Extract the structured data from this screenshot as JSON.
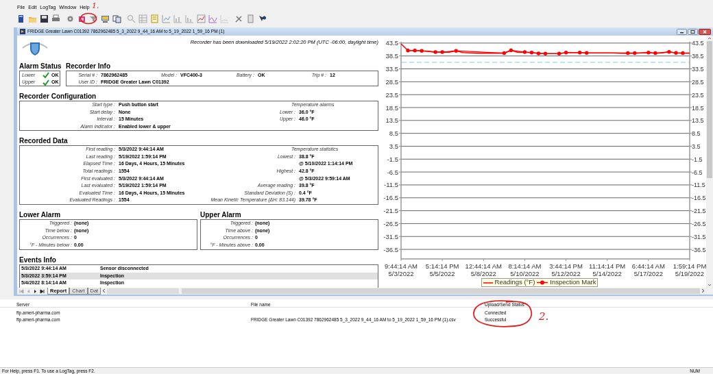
{
  "menu": [
    "File",
    "Edit",
    "LogTag",
    "Window",
    "Help"
  ],
  "markup": [
    {
      "text": "1."
    },
    {
      "text": "2."
    }
  ],
  "document": {
    "title": "FRIDGE Greater Lawn C01392 7862962485 5_3_2022 9_44_16 AM to 5_19_2022 1_59_16 PM (1)",
    "downloaded": "Recorder has been downloaded 5/19/2022 2:02:20 PM (UTC -06:00, daylight time)",
    "alarm_status": {
      "title": "Alarm Status",
      "rows": [
        {
          "label": "Lower",
          "value": "OK",
          "ok": true
        },
        {
          "label": "Upper",
          "value": "OK",
          "ok": true
        }
      ]
    },
    "recorder_info": {
      "title": "Recorder Info",
      "fields": [
        {
          "label": "Serial # :",
          "value": "7862962485"
        },
        {
          "label": "Model :",
          "value": "VFC400-3"
        },
        {
          "label": "Battery :",
          "value": "OK"
        },
        {
          "label": "Trip # :",
          "value": "12"
        },
        {
          "label": "User ID :",
          "value": "FRIDGE Greater Lawn C01392"
        }
      ]
    },
    "recorder_configuration": {
      "title": "Recorder Configuration",
      "left": [
        {
          "label": "Start type :",
          "value": "Push button start"
        },
        {
          "label": "Start delay :",
          "value": "None"
        },
        {
          "label": "Interval :",
          "value": "15 Minutes"
        },
        {
          "label": "Alarm indicator :",
          "value": "Enabled lower & upper"
        }
      ],
      "right_title": "Temperature alarms",
      "right": [
        {
          "label": "Lower :",
          "value": "36.0 °F"
        },
        {
          "label": "Upper :",
          "value": "46.0 °F"
        }
      ]
    },
    "recorded_data": {
      "title": "Recorded Data",
      "left": [
        {
          "label": "First reading :",
          "value": "5/3/2022 9:44:14 AM"
        },
        {
          "label": "Last reading :",
          "value": "5/19/2022 1:59:14 PM"
        },
        {
          "label": "Elapsed Time :",
          "value": "16 Days, 4 Hours, 15 Minutes"
        },
        {
          "label": "Total readings :",
          "value": "1554"
        },
        {
          "label": "First evaluated :",
          "value": "5/3/2022 9:44:14 AM"
        },
        {
          "label": "Last evaluated :",
          "value": "5/19/2022 1:59:14 PM"
        },
        {
          "label": "Evaluated Time :",
          "value": "16 Days, 4 Hours, 15 Minutes"
        },
        {
          "label": "Evaluated Readings :",
          "value": "1554"
        }
      ],
      "right_title": "Temperature statistics",
      "right": [
        {
          "label": "Lowest :",
          "value": "38.8 °F"
        },
        {
          "value": "@ 5/10/2022 1:14:14 PM"
        },
        {
          "label": "Highest :",
          "value": "42.8 °F"
        },
        {
          "value": "@ 5/3/2022 9:59:14 AM"
        },
        {
          "label": "Average reading :",
          "value": "39.8 °F"
        },
        {
          "label": "Standard Deviation (S) :",
          "value": "0.4 °F"
        },
        {
          "label": "Mean Kinetic Temperature (ΔH: 83.144)",
          "value": "39.78 °F"
        }
      ]
    },
    "lower_alarm": {
      "title": "Lower Alarm",
      "fields": [
        {
          "label": "Triggered :",
          "value": "(none)"
        },
        {
          "label": "Time below :",
          "value": "(none)"
        },
        {
          "label": "Occurrences :",
          "value": "0"
        },
        {
          "label": "°F - Minutes below :",
          "value": "0.00"
        }
      ]
    },
    "upper_alarm": {
      "title": "Upper Alarm",
      "fields": [
        {
          "label": "Triggered :",
          "value": "(none)"
        },
        {
          "label": "Time above :",
          "value": "(none)"
        },
        {
          "label": "Occurrences :",
          "value": "0"
        },
        {
          "label": "°F - Minutes above :",
          "value": "0.00"
        }
      ]
    },
    "events": {
      "title": "Events Info",
      "rows": [
        {
          "time": "5/3/2022 9:44:14 AM",
          "event": "Sensor disconnected",
          "selected": false
        },
        {
          "time": "5/3/2022 3:59:14 PM",
          "event": "Inspection",
          "selected": true
        },
        {
          "time": "5/4/2022 8:14:14 AM",
          "event": "Inspection",
          "selected": false
        }
      ]
    },
    "sheet_tabs": [
      {
        "label": "Report",
        "selected": true
      },
      {
        "label": "Chart",
        "selected": false
      },
      {
        "label": "Dat",
        "selected": false
      }
    ],
    "chart": {
      "chart_data": {
        "type": "line",
        "categories": [
          "9:44:14 AM\n5/3/2022",
          null,
          null,
          null,
          null,
          null,
          "5:14:14 PM\n5/5/2022",
          null,
          null,
          null,
          null,
          null,
          "12:44:14 AM\n5/8/2022",
          null,
          null,
          null,
          null,
          null,
          "8:14:14 AM\n5/10/2022",
          null,
          null,
          null,
          null,
          null,
          "3:44:14 PM\n5/12/2022",
          null,
          null,
          null,
          null,
          null,
          "11:14:14 PM\n5/14/2022",
          null,
          null,
          null,
          null,
          null,
          "6:44:14 AM\n5/17/2022",
          null,
          null,
          null,
          null,
          null,
          "1:59:14 PM\n5/19/2022"
        ],
        "series": [
          {
            "name": "Readings (°F)",
            "color": "#ff0000",
            "values": [
              43.2,
              40.6,
              40.6,
              40.5,
              40.3,
              40.0,
              40.0,
              40.0,
              40.5,
              39.8,
              39.7,
              39.6,
              39.6,
              39.6,
              39.6,
              39.6,
              40.7,
              39.9,
              40.0,
              39.8,
              39.5,
              39.4,
              39.4,
              39.4,
              39.8,
              39.8,
              39.8,
              39.7,
              39.7,
              39.7,
              39.7,
              39.7,
              39.6,
              39.6,
              39.6,
              39.7,
              39.8,
              39.6,
              39.7,
              40.1,
              39.7,
              39.6,
              39.6
            ]
          },
          {
            "name": "Inspection Mark",
            "color": "#ff0000",
            "values": [
              null,
              40.6,
              40.6,
              40.5,
              null,
              40.0,
              40.0,
              null,
              40.5,
              null,
              null,
              null,
              null,
              null,
              null,
              39.6,
              40.7,
              null,
              40.0,
              39.8,
              39.5,
              39.4,
              null,
              39.4,
              39.8,
              null,
              39.8,
              39.7,
              null,
              null,
              null,
              null,
              null,
              39.6,
              39.6,
              null,
              39.8,
              39.6,
              null,
              40.1,
              39.7,
              39.6,
              null
            ]
          }
        ],
        "ylim": [
          -40.2,
          44
        ],
        "yticks": [
          {
            "value": 43.5,
            "label": "43.5"
          },
          {
            "value": 38.5,
            "label": "38.5"
          },
          {
            "value": 33.5,
            "label": "33.5"
          },
          {
            "value": 28.5,
            "label": "28.5"
          },
          {
            "value": 23.5,
            "label": "23.5"
          },
          {
            "value": 18.5,
            "label": "18.5"
          },
          {
            "value": 13.5,
            "label": "13.5"
          },
          {
            "value": 8.5,
            "label": "8.5"
          },
          {
            "value": 3.5,
            "label": "3.5"
          },
          {
            "value": -1.5,
            "label": "-1.5"
          },
          {
            "value": -6.5,
            "label": "-6.5"
          },
          {
            "value": -11.5,
            "label": "-11.5"
          },
          {
            "value": -16.5,
            "label": "-16.5"
          },
          {
            "value": -21.5,
            "label": "-21.5"
          },
          {
            "value": -26.5,
            "label": "-26.5"
          },
          {
            "value": -31.5,
            "label": "-31.5"
          },
          {
            "value": -36.5,
            "label": "-36.5"
          }
        ],
        "grid": true,
        "legend": "bottom",
        "ref_lines": [
          {
            "axis": "y",
            "value": 36
          }
        ]
      },
      "right_axis_labels": [
        "43.5",
        "38.5",
        "33.5",
        "28.5",
        "23.5",
        "18.5",
        "13.5",
        "8.5",
        "3.5",
        "-1.5",
        "-6.5",
        "-11.5",
        "-16.5",
        "-21.5",
        "-26.5",
        "-31.5",
        "-36.5"
      ]
    }
  },
  "upload_panel": {
    "columns": [
      "Server",
      "File name",
      "Upload/Send Status"
    ],
    "rows": [
      {
        "server": "ftp.ameri-pharma.com",
        "status": "Connected"
      },
      {
        "server": "ftp.ameri-pharma.com",
        "file_name": "FRIDGE Greater Lawn C01392 7862962485 5_3_2022 9_44_16 AM to 5_19_2022 1_59_16 PM (1).csv",
        "status": "Successful"
      }
    ]
  },
  "status_bar": {
    "help": "For Help, press F1. To use a LogTag, press F2.",
    "indicator": "NUM"
  }
}
